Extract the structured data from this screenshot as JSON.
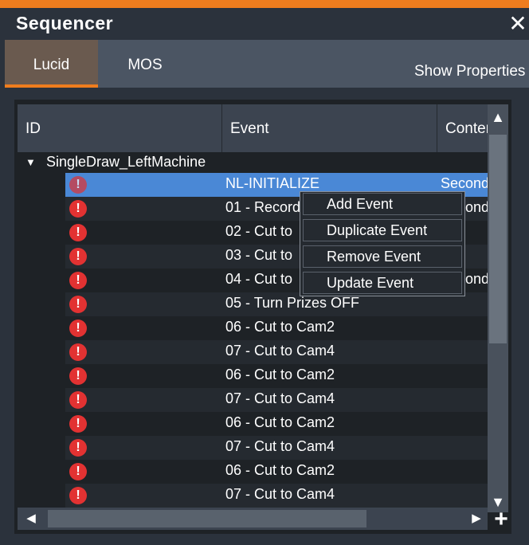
{
  "window": {
    "title": "Sequencer",
    "close_glyph": "✕",
    "accent": "#ef7d1e"
  },
  "tabs": [
    {
      "label": "Lucid",
      "active": true
    },
    {
      "label": "MOS",
      "active": false
    }
  ],
  "toolbar": {
    "show_properties_label": "Show Properties"
  },
  "table": {
    "columns": [
      "ID",
      "Event",
      "Content"
    ],
    "group": {
      "name": "SingleDraw_LeftMachine",
      "expanded": true,
      "arrow": "▼"
    },
    "rows": [
      {
        "status": "error",
        "status_glyph": "!",
        "event": "NL-INITIALIZE",
        "content": "Second",
        "selected": true
      },
      {
        "status": "error",
        "status_glyph": "!",
        "event": "01 - Record",
        "content": "Second"
      },
      {
        "status": "error",
        "status_glyph": "!",
        "event": "02 - Cut to",
        "content": ""
      },
      {
        "status": "error",
        "status_glyph": "!",
        "event": "03 - Cut to",
        "content": ""
      },
      {
        "status": "error",
        "status_glyph": "!",
        "event": "04 - Cut to",
        "content": "Second"
      },
      {
        "status": "error",
        "status_glyph": "!",
        "event": "05 - Turn Prizes OFF",
        "content": ""
      },
      {
        "status": "error",
        "status_glyph": "!",
        "event": "06 - Cut to Cam2",
        "content": ""
      },
      {
        "status": "error",
        "status_glyph": "!",
        "event": "07 - Cut to Cam4",
        "content": ""
      },
      {
        "status": "error",
        "status_glyph": "!",
        "event": "06 - Cut to Cam2",
        "content": ""
      },
      {
        "status": "error",
        "status_glyph": "!",
        "event": "07 - Cut to Cam4",
        "content": ""
      },
      {
        "status": "error",
        "status_glyph": "!",
        "event": "06 - Cut to Cam2",
        "content": ""
      },
      {
        "status": "error",
        "status_glyph": "!",
        "event": "07 - Cut to Cam4",
        "content": ""
      },
      {
        "status": "error",
        "status_glyph": "!",
        "event": "06 - Cut to Cam2",
        "content": ""
      },
      {
        "status": "error",
        "status_glyph": "!",
        "event": "07 - Cut to Cam4",
        "content": ""
      }
    ]
  },
  "context_menu": {
    "items": [
      "Add Event",
      "Duplicate Event",
      "Remove Event",
      "Update Event"
    ]
  },
  "scrollbars": {
    "up_glyph": "▲",
    "down_glyph": "▼",
    "left_glyph": "◀",
    "right_glyph": "▶"
  },
  "add_button": {
    "glyph": "+"
  },
  "colors": {
    "row_even": "#1e2226",
    "row_odd": "#252a30",
    "row_selected": "#4a88d6",
    "error": "#e23232"
  }
}
